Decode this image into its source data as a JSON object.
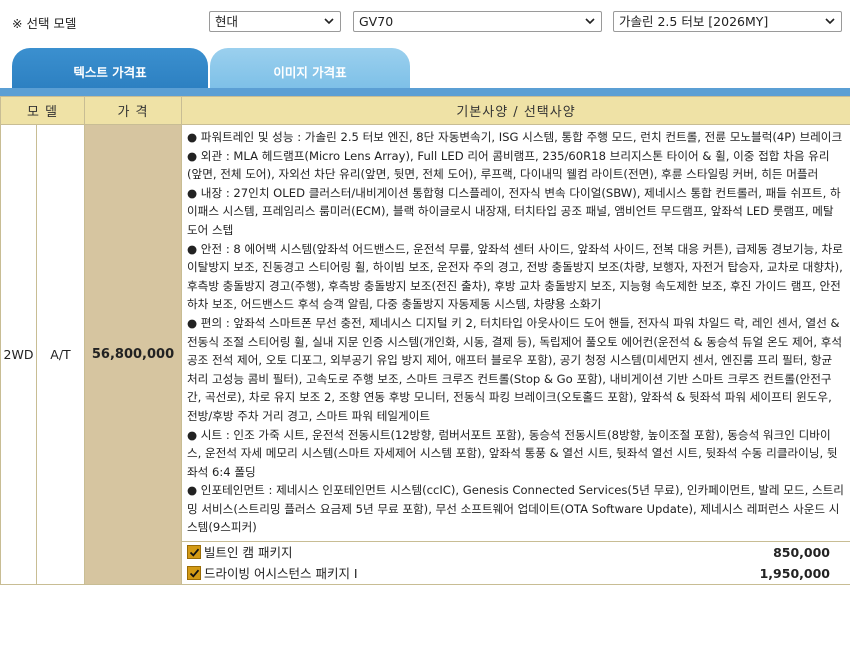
{
  "selector": {
    "label": "※ 선택 모델",
    "brand": "현대",
    "model": "GV70",
    "trim": "가솔린 2.5 터보 [2026MY]"
  },
  "tabs": [
    {
      "label": "텍스트 가격표",
      "active": true
    },
    {
      "label": "이미지 가격표",
      "active": false
    }
  ],
  "table": {
    "headers": {
      "model": "모 델",
      "price": "가 격",
      "spec": "기본사양 / 선택사양"
    },
    "row": {
      "drive": "2WD",
      "transmission": "A/T",
      "price": "56,800,000",
      "spec": [
        "● 파워트레인 및 성능 : 가솔린 2.5 터보 엔진, 8단 자동변속기, ISG 시스템, 통합 주행 모드, 런치 컨트롤, 전륜 모노블럭(4P) 브레이크",
        "● 외관 : MLA 헤드램프(Micro Lens Array), Full LED 리어 콤비램프, 235/60R18 브리지스톤 타이어 & 휠, 이중 접합 차음 유리(앞면, 전체 도어), 자외선 차단 유리(앞면, 뒷면, 전체 도어), 루프랙, 다이내믹 웰컴 라이트(전면), 후륜 스타일링 커버, 히든 머플러",
        "● 내장 : 27인치 OLED 클러스터/내비게이션 통합형 디스플레이, 전자식 변속 다이얼(SBW), 제네시스 통합 컨트롤러, 패들 쉬프트, 하이패스 시스템, 프레임리스 룸미러(ECM), 블랙 하이글로시 내장재, 터치타입 공조 패널, 앰비언트 무드램프, 앞좌석 LED 룻램프, 메탈 도어 스텝",
        "● 안전 : 8 에어백 시스템(앞좌석 어드밴스드, 운전석 무릎, 앞좌석 센터 사이드, 앞좌석 사이드, 전복 대응 커튼), 급제동 경보기능, 차로 이탈방지 보조, 진동경고 스티어링 휠, 하이빔 보조, 운전자 주의 경고, 전방 충돌방지 보조(차량, 보행자, 자전거 탑승자, 교차로 대향차), 후측방 충돌방지 경고(주행), 후측방 충돌방지 보조(전진 출차), 후방 교차 충돌방지 보조, 지능형 속도제한 보조, 후진 가이드 램프, 안전 하차 보조, 어드밴스드 후석 승객 알림, 다중 충돌방지 자동제동 시스템, 차량용 소화기",
        "● 편의 : 앞좌석 스마트폰 무선 충전, 제네시스 디지털 키 2, 터치타입 아웃사이드 도어 핸들, 전자식 파워 차일드 락, 레인 센서, 열선 & 전동식 조절 스티어링 휠, 실내 지문 인증 시스템(개인화, 시동, 결제 등), 독립제어 풀오토 에어컨(운전석 & 동승석 듀얼 온도 제어, 후석 공조 전석 제어, 오토 디포그, 외부공기 유입 방지 제어, 애프터 블로우 포함), 공기 청정 시스템(미세먼지 센서, 엔진룸 프리 필터, 항균 처리 고성능 콤비 필터), 고속도로 주행 보조, 스마트 크루즈 컨트롤(Stop & Go 포함), 내비게이션 기반 스마트 크루즈 컨트롤(안전구간, 곡선로), 차로 유지 보조 2, 조향 연동 후방 모니터, 전동식 파킹 브레이크(오토홀드 포함), 앞좌석 & 뒷좌석 파워 세이프티 윈도우, 전방/후방 주차 거리 경고, 스마트 파워 테일게이트",
        "● 시트 : 인조 가죽 시트, 운전석 전동시트(12방향, 럼버서포트 포함), 동승석 전동시트(8방향, 높이조절 포함), 동승석 워크인 디바이스, 운전석 자세 메모리 시스템(스마트 자세제어 시스템 포함), 앞좌석 통풍 & 열선 시트, 뒷좌석 열선 시트, 뒷좌석 수동 리클라이닝, 뒷좌석 6:4 폴딩",
        "● 인포테인먼트 : 제네시스 인포테인먼트 시스템(ccIC), Genesis Connected Services(5년 무료), 인카페이먼트, 발레 모드, 스트리밍 서비스(스트리밍 플러스 요금제 5년 무료 포함), 무선 소프트웨어 업데이트(OTA Software Update), 제네시스 레퍼런스 사운드 시스템(9스피커)"
      ],
      "options": [
        {
          "name": "빌트인 캠 패키지",
          "price": "850,000",
          "checked": true
        },
        {
          "name": "드라이빙 어시스턴스 패키지 Ⅰ",
          "price": "1,950,000",
          "checked": true
        }
      ]
    }
  },
  "colors": {
    "header_bg": "#efe2a6",
    "price_bg": "#d6c5a0",
    "tab_active": "#2a7dbf",
    "tab_inactive": "#78bde6",
    "checkbox": "#d39a14"
  }
}
